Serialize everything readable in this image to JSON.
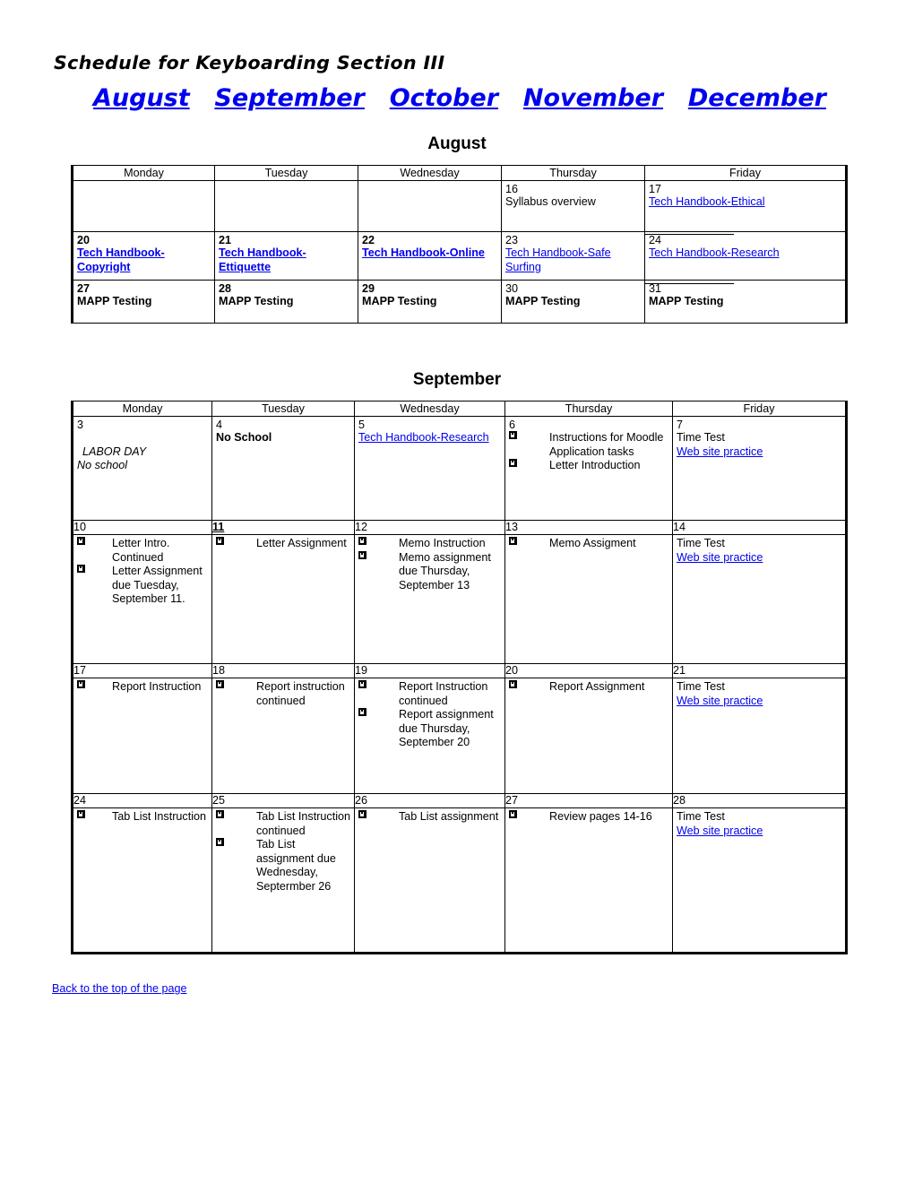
{
  "document": {
    "title": "Schedule for Keyboarding Section III",
    "back_to_top": "Back to the top of the page"
  },
  "month_nav": [
    {
      "label": "August"
    },
    {
      "label": "September"
    },
    {
      "label": "October"
    },
    {
      "label": "November"
    },
    {
      "label": "December"
    }
  ],
  "colors": {
    "link": "#0000ee",
    "text": "#000000",
    "border": "#000000",
    "background": "#ffffff"
  },
  "weekday_headers": [
    "Monday",
    "Tuesday",
    "Wednesday",
    "Thursday",
    "Friday"
  ],
  "august": {
    "title": "August",
    "headers": [
      "Monday",
      "Tuesday",
      "Wednesday",
      "Thursday",
      "Friday"
    ],
    "weeks": [
      {
        "days": [
          {
            "date": "",
            "lines": []
          },
          {
            "date": "",
            "lines": []
          },
          {
            "date": "",
            "lines": []
          },
          {
            "date": "16",
            "date_bold": false,
            "lines": [
              {
                "text": "Syllabus overview",
                "link": false,
                "bold": false
              }
            ]
          },
          {
            "date": "17",
            "date_bold": false,
            "lines": [
              {
                "text": "Tech Handbook-Ethical",
                "link": true,
                "bold": false
              }
            ]
          }
        ]
      },
      {
        "days": [
          {
            "date": "20",
            "date_bold": true,
            "lines": [
              {
                "text": "Tech Handbook-Copyright",
                "link": true,
                "bold": true
              }
            ]
          },
          {
            "date": "21",
            "date_bold": true,
            "lines": [
              {
                "text": "Tech Handbook-Ettiquette",
                "link": true,
                "bold": true
              }
            ]
          },
          {
            "date": "22",
            "date_bold": true,
            "lines": [
              {
                "text": "Tech Handbook-Online",
                "link": true,
                "bold": true
              }
            ]
          },
          {
            "date": "23",
            "date_bold": false,
            "lines": [
              {
                "text": "Tech Handbook-Safe Surfing",
                "link": true,
                "bold": false
              }
            ]
          },
          {
            "date": "24",
            "date_bold": false,
            "lines": [
              {
                "text": "Tech Handbook-Research",
                "link": true,
                "bold": false
              }
            ]
          }
        ]
      },
      {
        "days": [
          {
            "date": "27",
            "date_bold": true,
            "lines": [
              {
                "text": "MAPP Testing",
                "link": false,
                "bold": true
              }
            ]
          },
          {
            "date": "28",
            "date_bold": true,
            "lines": [
              {
                "text": "MAPP Testing",
                "link": false,
                "bold": true
              }
            ]
          },
          {
            "date": "29",
            "date_bold": true,
            "lines": [
              {
                "text": "MAPP Testing",
                "link": false,
                "bold": true
              }
            ]
          },
          {
            "date": "30",
            "date_bold": false,
            "lines": [
              {
                "text": "MAPP Testing",
                "link": false,
                "bold": true
              }
            ]
          },
          {
            "date": "31",
            "date_bold": false,
            "lines": [
              {
                "text": "MAPP Testing",
                "link": false,
                "bold": true
              }
            ]
          }
        ]
      }
    ]
  },
  "september": {
    "title": "September",
    "headers": [
      "Monday",
      "Tuesday",
      "Wednesday",
      "Thursday",
      "Friday"
    ],
    "week1": {
      "days": [
        {
          "date": "3",
          "date_bold": false,
          "blank_line": true,
          "plain": [
            {
              "text": "LABOR DAY",
              "italic": true,
              "indent": true
            },
            {
              "text": "No school",
              "italic": true,
              "indent": false
            }
          ]
        },
        {
          "date": "4",
          "date_bold": false,
          "plain": [
            {
              "text": "No School",
              "bold": true
            }
          ]
        },
        {
          "date": "5",
          "date_bold": false,
          "plain": [
            {
              "text": "Tech Handbook-Research",
              "link": true
            }
          ]
        },
        {
          "date": "6",
          "date_bold": false,
          "bullets": [
            "Instructions for Moodle Application tasks",
            "Letter Introduction"
          ]
        },
        {
          "date": "7",
          "date_bold": false,
          "plain": [
            {
              "text": "Time Test"
            },
            {
              "text": "Web site practice",
              "link": true
            }
          ]
        }
      ]
    },
    "weeks": [
      {
        "dates": [
          {
            "n": "10",
            "bold": false
          },
          {
            "n": "11",
            "bold": true
          },
          {
            "n": "12",
            "bold": false
          },
          {
            "n": "13",
            "bold": false
          },
          {
            "n": "14",
            "bold": false
          }
        ],
        "days": [
          {
            "bullets": [
              "Letter Intro. Continued",
              "Letter Assignment due Tuesday, September 11."
            ]
          },
          {
            "bullets": [
              "Letter Assignment"
            ]
          },
          {
            "bullets": [
              "Memo Instruction",
              "Memo assignment due Thursday, September 13"
            ]
          },
          {
            "bullets": [
              "Memo Assigment"
            ]
          },
          {
            "plain": [
              {
                "text": "Time Test"
              },
              {
                "text": "Web site practice",
                "link": true
              }
            ]
          }
        ]
      },
      {
        "dates": [
          {
            "n": "17",
            "bold": false
          },
          {
            "n": "18",
            "bold": false
          },
          {
            "n": "19",
            "bold": false
          },
          {
            "n": "20",
            "bold": false
          },
          {
            "n": "21",
            "bold": false
          }
        ],
        "days": [
          {
            "bullets": [
              "Report Instruction"
            ]
          },
          {
            "bullets": [
              "Report instruction continued"
            ]
          },
          {
            "bullets": [
              "Report Instruction continued",
              "Report assignment due Thursday, September 20"
            ]
          },
          {
            "bullets": [
              "Report Assignment"
            ]
          },
          {
            "plain": [
              {
                "text": "Time Test"
              },
              {
                "text": "Web site practice",
                "link": true
              }
            ]
          }
        ]
      },
      {
        "dates": [
          {
            "n": "24",
            "bold": false
          },
          {
            "n": "25",
            "bold": false
          },
          {
            "n": "26",
            "bold": false
          },
          {
            "n": "27",
            "bold": false
          },
          {
            "n": "28",
            "bold": false
          }
        ],
        "days": [
          {
            "bullets": [
              "Tab List Instruction"
            ]
          },
          {
            "bullets": [
              "Tab List Instruction continued",
              "Tab List assignment due Wednesday, Septermber 26"
            ]
          },
          {
            "bullets": [
              "Tab List assignment"
            ]
          },
          {
            "bullets": [
              "Review pages 14-16"
            ]
          },
          {
            "plain": [
              {
                "text": "Time Test"
              },
              {
                "text": "Web site practice",
                "link": true
              }
            ]
          }
        ]
      }
    ]
  }
}
